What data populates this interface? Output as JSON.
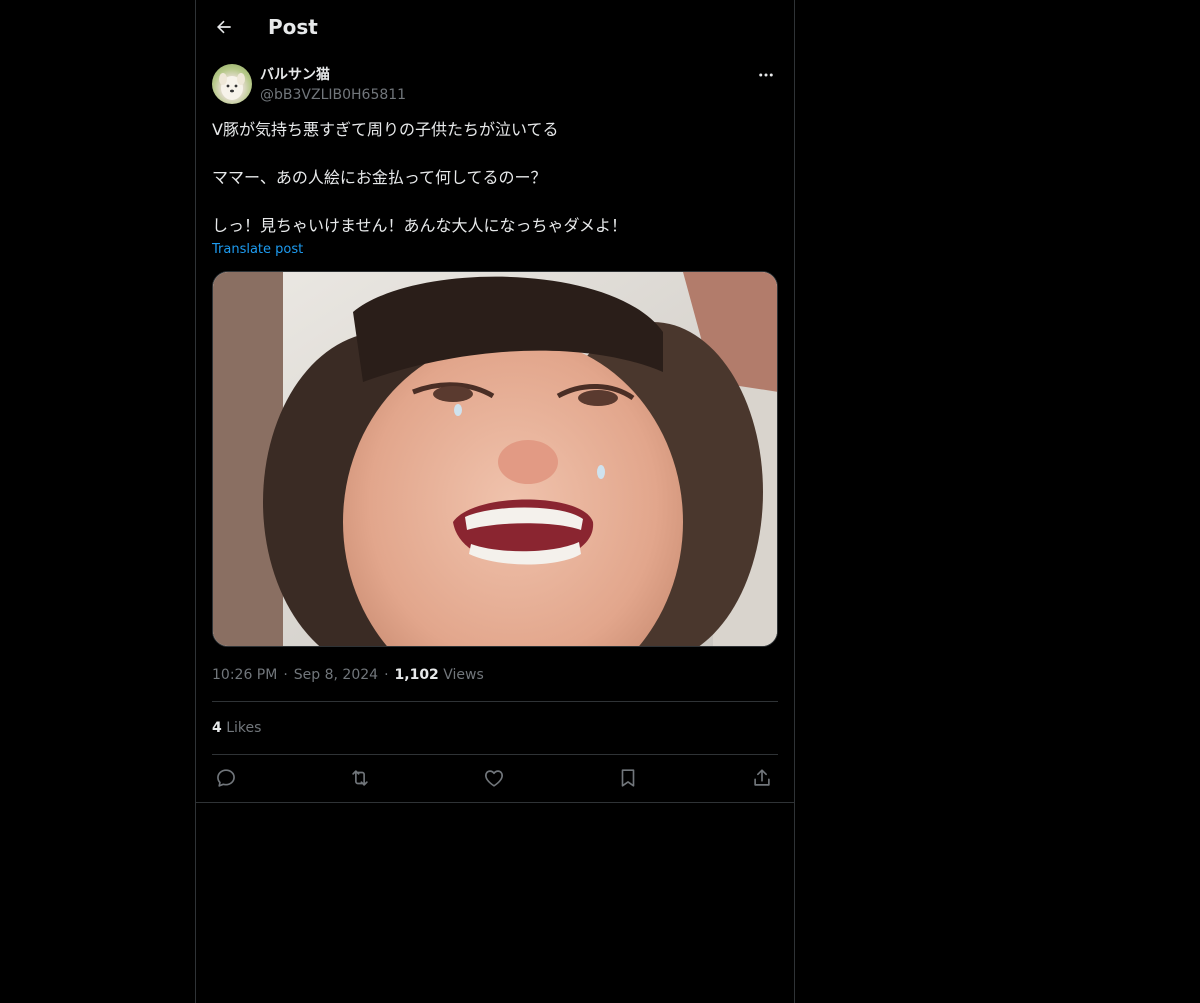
{
  "header": {
    "title": "Post",
    "back_icon": "arrow-left-icon"
  },
  "author": {
    "display_name": "バルサン猫",
    "handle": "@bB3VZLIB0H65811",
    "more_icon": "more-horizontal-icon"
  },
  "post": {
    "lines": [
      "V豚が気持ち悪すぎて周りの子供たちが泣いてる",
      "",
      "ママー、あの人絵にお金払って何してるのー？",
      "",
      "しっ！見ちゃいけません！あんな大人になっちゃダメよ！"
    ],
    "translate_label": "Translate post"
  },
  "meta": {
    "time": "10:26 PM",
    "separator": "·",
    "date": "Sep 8, 2024",
    "views_count": "1,102",
    "views_label": "Views"
  },
  "engagement": {
    "likes_count": "4",
    "likes_label": "Likes"
  },
  "actions": [
    {
      "icon": "reply-icon"
    },
    {
      "icon": "retweet-icon"
    },
    {
      "icon": "like-heart-icon"
    },
    {
      "icon": "bookmark-icon"
    },
    {
      "icon": "share-icon"
    }
  ],
  "colors": {
    "background": "#000000",
    "text": "#e7e9ea",
    "muted": "#71767b",
    "link": "#1d9bf0",
    "border": "#2f3336"
  }
}
